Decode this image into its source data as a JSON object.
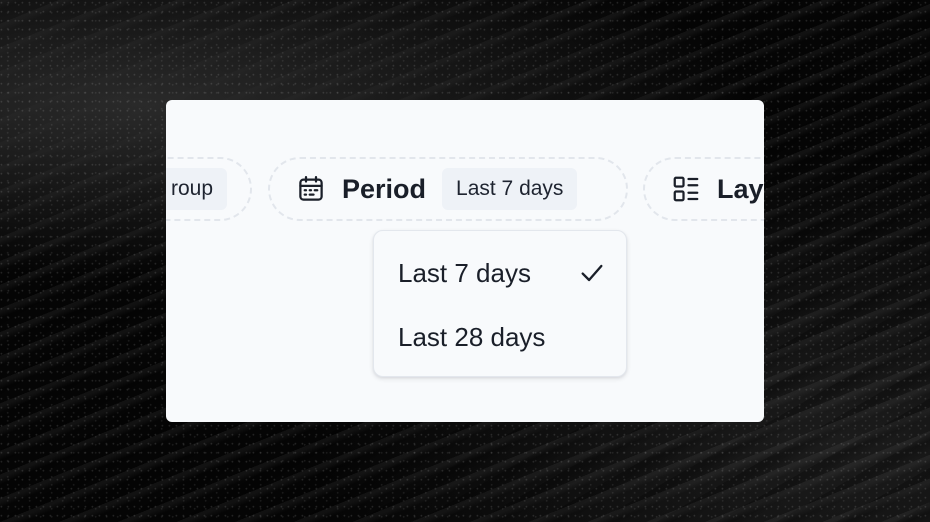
{
  "toolbar": {
    "group_filter": {
      "value_label": "roup"
    },
    "period_filter": {
      "label": "Period",
      "value_label": "Last 7 days",
      "icon": "calendar-icon"
    },
    "layout_filter": {
      "label": "Lay",
      "icon": "layout-list-icon"
    }
  },
  "period_dropdown": {
    "options": [
      {
        "label": "Last 7 days",
        "selected": true
      },
      {
        "label": "Last 28 days",
        "selected": false
      }
    ],
    "selected_icon": "check-icon"
  },
  "colors": {
    "card_background": "#f8fafc",
    "chip_background": "#eef2f7",
    "text": "#1a1f29",
    "dashed_border": "#e2e6ec"
  }
}
